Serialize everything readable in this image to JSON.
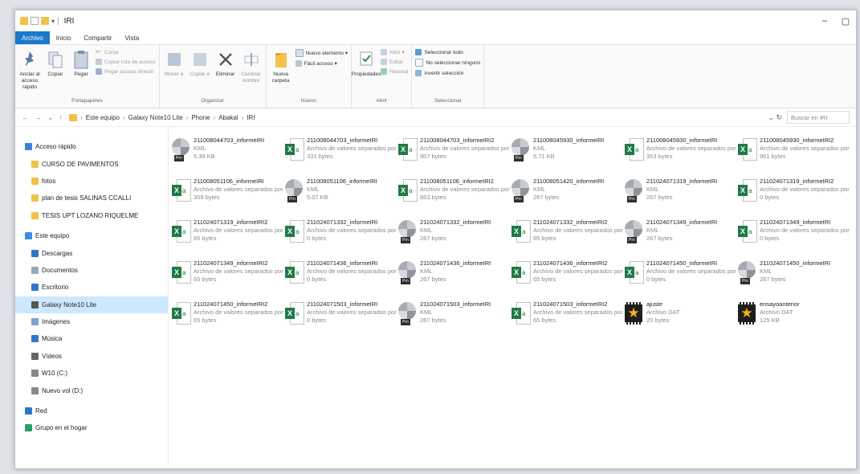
{
  "window": {
    "title": "IRI"
  },
  "tabs": [
    {
      "label": "Archivo"
    },
    {
      "label": "Inicio"
    },
    {
      "label": "Compartir"
    },
    {
      "label": "Vista"
    }
  ],
  "ribbon": {
    "portapapeles": {
      "label": "Portapapeles",
      "anclar": "Anclar al acceso rápido",
      "copiar": "Copiar",
      "pegar": "Pegar",
      "cortar": "Cortar",
      "copiar_ruta": "Copiar ruta de acceso",
      "pegar_acceso": "Pegar acceso directo"
    },
    "organizar": {
      "label": "Organizar",
      "mover": "Mover a",
      "copiar_a": "Copiar a",
      "eliminar": "Eliminar",
      "cambiar": "Cambiar nombre"
    },
    "nuevo": {
      "label": "Nuevo",
      "carpeta": "Nueva carpeta",
      "elemento": "Nuevo elemento ▾",
      "facil": "Fácil acceso ▾"
    },
    "abrir": {
      "label": "Abrir",
      "propiedades": "Propiedades",
      "abrir": "Abrir ▾",
      "editar": "Editar",
      "historial": "Historial"
    },
    "seleccionar": {
      "label": "Seleccionar",
      "todo": "Seleccionar todo",
      "ninguno": "No seleccionar ninguno",
      "invertir": "Invertir selección"
    }
  },
  "address": {
    "crumbs": [
      "Este equipo",
      "Galaxy Note10 Lite",
      "Phone",
      "Abakal",
      "IRI"
    ],
    "search_placeholder": "Buscar en IRI"
  },
  "sidebar": [
    {
      "label": "Acceso rápido",
      "icon": "star-icon",
      "indent": false,
      "selected": false
    },
    {
      "label": "CURSO DE PAVIMENTOS",
      "icon": "folder-icon",
      "indent": true,
      "selected": false
    },
    {
      "label": "fotos",
      "icon": "folder-icon",
      "indent": true,
      "selected": false
    },
    {
      "label": "plan de tesis SALINAS CCALLI",
      "icon": "folder-icon",
      "indent": true,
      "selected": false
    },
    {
      "label": "TESIS UPT LOZANO RIQUELME",
      "icon": "folder-icon",
      "indent": true,
      "selected": false
    },
    {
      "label": "Este equipo",
      "icon": "computer-icon",
      "indent": false,
      "selected": false
    },
    {
      "label": "Descargas",
      "icon": "download-icon",
      "indent": true,
      "selected": false
    },
    {
      "label": "Documentos",
      "icon": "document-icon",
      "indent": true,
      "selected": false
    },
    {
      "label": "Escritorio",
      "icon": "desktop-icon",
      "indent": true,
      "selected": false
    },
    {
      "label": "Galaxy Note10 Lite",
      "icon": "phone-icon",
      "indent": true,
      "selected": true
    },
    {
      "label": "Imágenes",
      "icon": "image-icon",
      "indent": true,
      "selected": false
    },
    {
      "label": "Música",
      "icon": "music-icon",
      "indent": true,
      "selected": false
    },
    {
      "label": "Vídeos",
      "icon": "video-icon",
      "indent": true,
      "selected": false
    },
    {
      "label": "W10 (C:)",
      "icon": "drive-icon",
      "indent": true,
      "selected": false
    },
    {
      "label": "Nuevo vol (D:)",
      "icon": "drive-icon",
      "indent": true,
      "selected": false
    },
    {
      "label": "Red",
      "icon": "network-icon",
      "indent": false,
      "selected": false
    },
    {
      "label": "Grupo en el hogar",
      "icon": "homegroup-icon",
      "indent": false,
      "selected": false
    }
  ],
  "files": [
    {
      "name": "211008044703_informeIRI",
      "type": "KML",
      "size": "5.39 KB",
      "icon": "kml"
    },
    {
      "name": "211008044703_informeIRI",
      "type": "Archivo de valores separados por ...",
      "size": "331 bytes",
      "icon": "csv"
    },
    {
      "name": "211008044703_informeIRI2",
      "type": "Archivo de valores separados por ...",
      "size": "907 bytes",
      "icon": "csv"
    },
    {
      "name": "211008045930_informeIRI",
      "type": "KML",
      "size": "5.71 KB",
      "icon": "kml"
    },
    {
      "name": "211008045930_informeIRI",
      "type": "Archivo de valores separados por ...",
      "size": "353 bytes",
      "icon": "csv"
    },
    {
      "name": "211008045930_informeIRI2",
      "type": "Archivo de valores separados por ...",
      "size": "961 bytes",
      "icon": "csv"
    },
    {
      "name": "211008051106_informeIRI",
      "type": "Archivo de valores separados por ...",
      "size": "309 bytes",
      "icon": "csv"
    },
    {
      "name": "211008051106_informeIRI",
      "type": "KML",
      "size": "5.07 KB",
      "icon": "kml"
    },
    {
      "name": "211008051106_informeIRI2",
      "type": "Archivo de valores separados por ...",
      "size": "853 bytes",
      "icon": "csv"
    },
    {
      "name": "211008051420_informeIRI",
      "type": "KML",
      "size": "267 bytes",
      "icon": "kml"
    },
    {
      "name": "211024071319_informeIRI",
      "type": "KML",
      "size": "267 bytes",
      "icon": "kml"
    },
    {
      "name": "211024071319_informeIRI2",
      "type": "Archivo de valores separados por ...",
      "size": "0 bytes",
      "icon": "csv"
    },
    {
      "name": "211024071319_informeIRI2",
      "type": "Archivo de valores separados por ...",
      "size": "65 bytes",
      "icon": "csv"
    },
    {
      "name": "211024071332_informeIRI",
      "type": "Archivo de valores separados por ...",
      "size": "0 bytes",
      "icon": "csv"
    },
    {
      "name": "211024071332_informeIRI",
      "type": "KML",
      "size": "267 bytes",
      "icon": "kml"
    },
    {
      "name": "211024071332_informeIRI2",
      "type": "Archivo de valores separados por ...",
      "size": "65 bytes",
      "icon": "csv"
    },
    {
      "name": "211024071349_informeIRI",
      "type": "KML",
      "size": "267 bytes",
      "icon": "kml"
    },
    {
      "name": "211024071349_informeIRI",
      "type": "Archivo de valores separados por ...",
      "size": "0 bytes",
      "icon": "csv"
    },
    {
      "name": "211024071349_informeIRI2",
      "type": "Archivo de valores separados por ...",
      "size": "65 bytes",
      "icon": "csv"
    },
    {
      "name": "211024071436_informeIRI",
      "type": "Archivo de valores separados por ...",
      "size": "0 bytes",
      "icon": "csv"
    },
    {
      "name": "211024071436_informeIRI",
      "type": "KML",
      "size": "267 bytes",
      "icon": "kml"
    },
    {
      "name": "211024071436_informeIRI2",
      "type": "Archivo de valores separados por ...",
      "size": "65 bytes",
      "icon": "csv"
    },
    {
      "name": "211024071450_informeIRI",
      "type": "Archivo de valores separados por ...",
      "size": "0 bytes",
      "icon": "csv"
    },
    {
      "name": "211024071450_informeIRI",
      "type": "KML",
      "size": "267 bytes",
      "icon": "kml"
    },
    {
      "name": "211024071450_informeIRI2",
      "type": "Archivo de valores separados por ...",
      "size": "65 bytes",
      "icon": "csv"
    },
    {
      "name": "211024071503_informeIRI",
      "type": "Archivo de valores separados por ...",
      "size": "0 bytes",
      "icon": "csv"
    },
    {
      "name": "211024071503_informeIRI",
      "type": "KML",
      "size": "267 bytes",
      "icon": "kml"
    },
    {
      "name": "211024071503_informeIRI2",
      "type": "Archivo de valores separados por ...",
      "size": "65 bytes",
      "icon": "csv"
    },
    {
      "name": "ajuste",
      "type": "Archivo DAT",
      "size": "20 bytes",
      "icon": "dat"
    },
    {
      "name": "ensayoanterior",
      "type": "Archivo DAT",
      "size": "125 KB",
      "icon": "dat"
    }
  ]
}
